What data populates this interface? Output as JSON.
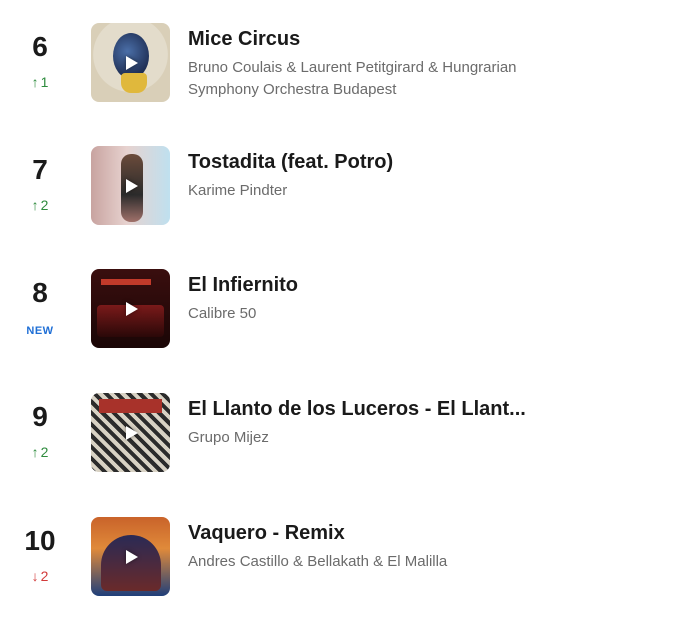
{
  "chart": {
    "entries": [
      {
        "rank": "6",
        "change_symbol": "↑",
        "change_value": "1",
        "change_type": "up",
        "title": "Mice Circus",
        "artist": "Bruno Coulais & Laurent Petitgirard & Hungrarian Symphony Orchestra Budapest"
      },
      {
        "rank": "7",
        "change_symbol": "↑",
        "change_value": "2",
        "change_type": "up",
        "title": "Tostadita (feat. Potro)",
        "artist": "Karime Pindter"
      },
      {
        "rank": "8",
        "change_symbol": "",
        "change_value": "NEW",
        "change_type": "new",
        "title": "El Infiernito",
        "artist": "Calibre 50"
      },
      {
        "rank": "9",
        "change_symbol": "↑",
        "change_value": "2",
        "change_type": "up",
        "title": "El Llanto de los Luceros - El Llant...",
        "artist": "Grupo Mijez"
      },
      {
        "rank": "10",
        "change_symbol": "↓",
        "change_value": "2",
        "change_type": "down",
        "title": "Vaquero - Remix",
        "artist": "Andres Castillo & Bellakath & El Malilla"
      }
    ]
  },
  "colors": {
    "up": "#2e8b3d",
    "down": "#d23a3a",
    "new": "#1f6fd6"
  },
  "icons": {
    "play": "play-icon"
  }
}
